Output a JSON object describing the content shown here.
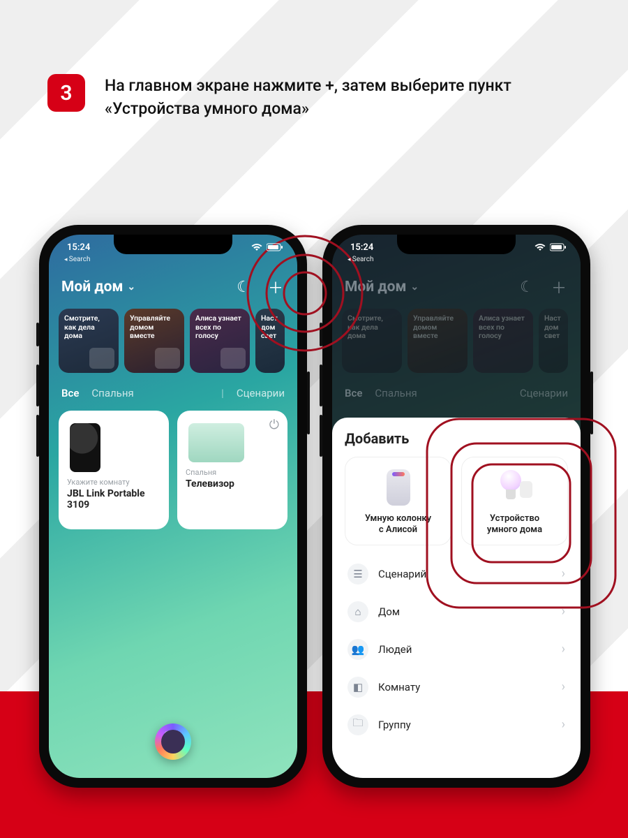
{
  "step": {
    "number": "3",
    "text": "На главном экране нажмите +, затем выберите пункт «Устройства умного дома»"
  },
  "status": {
    "time": "15:24",
    "back_crumb": "Search"
  },
  "home": {
    "title": "Мой дом",
    "promos": [
      "Смотрите, как дела дома",
      "Управляйте домом вместе",
      "Алиса узнает всех по голосу",
      "Наст дом свет"
    ],
    "tabs": {
      "all": "Все",
      "bedroom": "Спальня",
      "scenarios": "Сценарии"
    },
    "card1": {
      "room": "Укажите комнату",
      "name": "JBL Link Portable 3109"
    },
    "card2": {
      "room": "Спальня",
      "name": "Телевизор"
    }
  },
  "sheet": {
    "title": "Добавить",
    "card1": {
      "line1": "Умную колонку",
      "line2": "с Алисой"
    },
    "card2": {
      "line1": "Устройство",
      "line2": "умного дома"
    },
    "items": {
      "scenario": "Сценарий",
      "home": "Дом",
      "people": "Людей",
      "room": "Комнату",
      "group": "Группу"
    }
  }
}
